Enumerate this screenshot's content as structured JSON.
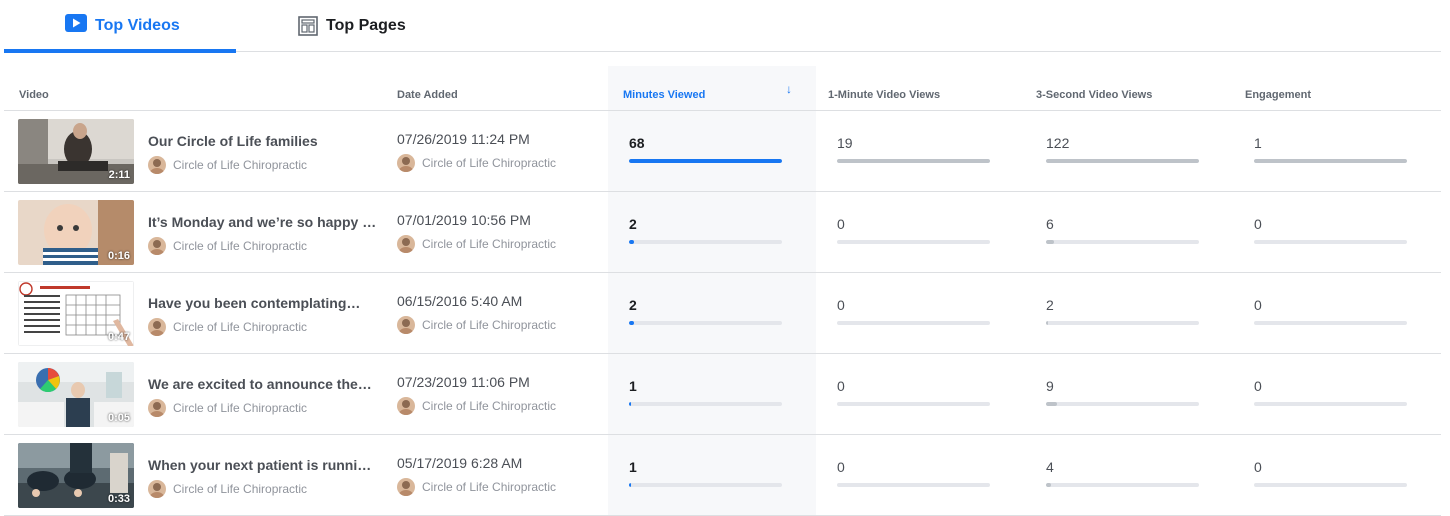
{
  "tabs": [
    {
      "label": "Top Videos",
      "icon": "play-video-icon",
      "active": true
    },
    {
      "label": "Top Pages",
      "icon": "page-layout-icon",
      "active": false
    }
  ],
  "columns": {
    "video": "Video",
    "date_added": "Date Added",
    "minutes_viewed": "Minutes Viewed",
    "one_minute_views": "1-Minute Video Views",
    "three_second_views": "3-Second Video Views",
    "engagement": "Engagement"
  },
  "sort": {
    "column": "minutes_viewed",
    "direction": "descending"
  },
  "colors": {
    "accent": "#1877f2",
    "bar_track": "#e4e6eb",
    "bar_fill": "#bec3c9"
  },
  "rows": [
    {
      "title": "Our Circle of Life families",
      "author": "Circle of Life Chiropractic",
      "duration": "2:11",
      "date": "07/26/2019 11:24 PM",
      "date_author": "Circle of Life Chiropractic",
      "minutes_viewed": "68",
      "minutes_fraction": 1.0,
      "one_minute": "19",
      "one_minute_fraction": 1.0,
      "three_second": "122",
      "three_second_fraction": 1.0,
      "engagement": "1",
      "engagement_fraction": 1.0
    },
    {
      "title": "It’s Monday and we’re so happy to …",
      "author": "Circle of Life Chiropractic",
      "duration": "0:16",
      "date": "07/01/2019 10:56 PM",
      "date_author": "Circle of Life Chiropractic",
      "minutes_viewed": "2",
      "minutes_fraction": 0.03,
      "one_minute": "0",
      "one_minute_fraction": 0,
      "three_second": "6",
      "three_second_fraction": 0.05,
      "engagement": "0",
      "engagement_fraction": 0
    },
    {
      "title": "Have you been contemplating…",
      "author": "Circle of Life Chiropractic",
      "duration": "0:47",
      "date": "06/15/2016 5:40 AM",
      "date_author": "Circle of Life Chiropractic",
      "minutes_viewed": "2",
      "minutes_fraction": 0.03,
      "one_minute": "0",
      "one_minute_fraction": 0,
      "three_second": "2",
      "three_second_fraction": 0.016,
      "engagement": "0",
      "engagement_fraction": 0
    },
    {
      "title": "We are excited to announce the…",
      "author": "Circle of Life Chiropractic",
      "duration": "0:05",
      "date": "07/23/2019 11:06 PM",
      "date_author": "Circle of Life Chiropractic",
      "minutes_viewed": "1",
      "minutes_fraction": 0.015,
      "one_minute": "0",
      "one_minute_fraction": 0,
      "three_second": "9",
      "three_second_fraction": 0.074,
      "engagement": "0",
      "engagement_fraction": 0
    },
    {
      "title": "When your next patient is running…",
      "author": "Circle of Life Chiropractic",
      "duration": "0:33",
      "date": "05/17/2019 6:28 AM",
      "date_author": "Circle of Life Chiropractic",
      "minutes_viewed": "1",
      "minutes_fraction": 0.015,
      "one_minute": "0",
      "one_minute_fraction": 0,
      "three_second": "4",
      "three_second_fraction": 0.033,
      "engagement": "0",
      "engagement_fraction": 0
    }
  ]
}
